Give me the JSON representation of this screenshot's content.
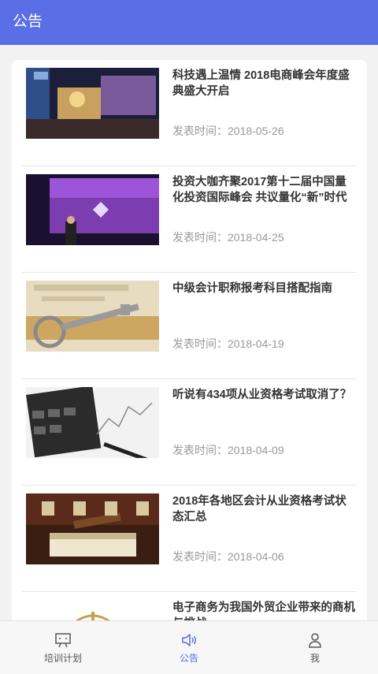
{
  "header": {
    "title": "公告"
  },
  "announcements": [
    {
      "title": "科技遇上温情 2018电商峰会年度盛典盛大开启",
      "date": "发表时间：2018-05-26",
      "image": "conference-stage-image"
    },
    {
      "title": "投资大咖齐聚2017第十二届中国量化投资国际峰会 共议量化“新”时代",
      "date": "发表时间：2018-04-25",
      "image": "summit-speaker-image"
    },
    {
      "title": "中级会计职称报考科目搭配指南",
      "date": "发表时间：2018-04-19",
      "image": "key-on-paper-image"
    },
    {
      "title": "听说有434项从业资格考试取消了？",
      "date": "发表时间：2018-04-09",
      "image": "calculator-pen-image"
    },
    {
      "title": "2018年各地区会计从业资格考试状态汇总",
      "date": "发表时间：2018-04-06",
      "image": "books-gavel-image"
    },
    {
      "title": "电子商务为我国外贸企业带来的商机与挑战",
      "date": "",
      "image": "scale-image"
    }
  ],
  "tabbar": {
    "tabs": [
      {
        "label": "培训计划",
        "icon": "presentation-icon",
        "active": false
      },
      {
        "label": "公告",
        "icon": "speaker-icon",
        "active": true
      },
      {
        "label": "我",
        "icon": "user-icon",
        "active": false
      }
    ]
  },
  "colors": {
    "accent": "#5a6ee5",
    "text": "#333333",
    "muted": "#999999"
  }
}
